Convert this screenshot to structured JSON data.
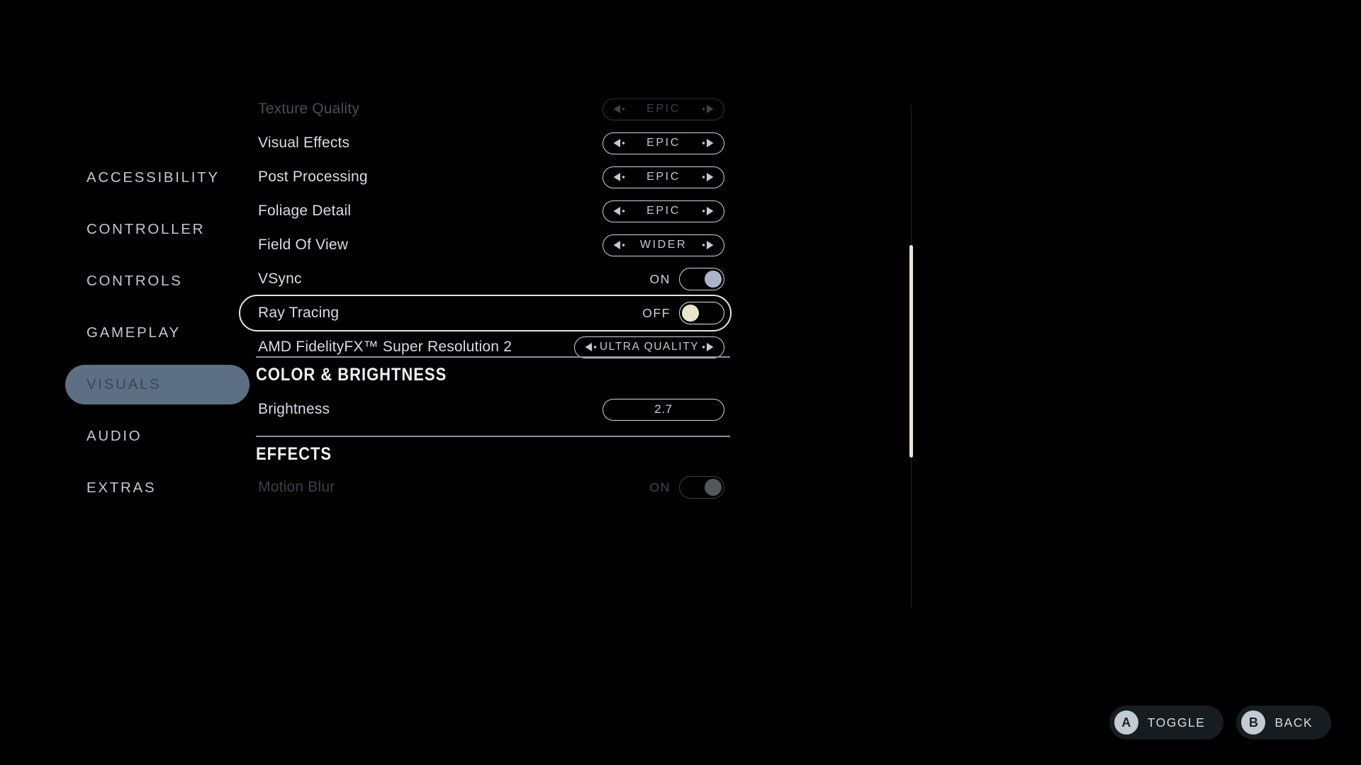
{
  "sidebar": {
    "items": [
      {
        "label": "ACCESSIBILITY",
        "active": false
      },
      {
        "label": "CONTROLLER",
        "active": false
      },
      {
        "label": "CONTROLS",
        "active": false
      },
      {
        "label": "GAMEPLAY",
        "active": false
      },
      {
        "label": "VISUALS",
        "active": true
      },
      {
        "label": "AUDIO",
        "active": false
      },
      {
        "label": "EXTRAS",
        "active": false
      }
    ]
  },
  "settings": {
    "rows": [
      {
        "label": "Texture Quality",
        "type": "selector",
        "value": "EPIC",
        "dimmed": true
      },
      {
        "label": "Visual Effects",
        "type": "selector",
        "value": "EPIC",
        "dimmed": false
      },
      {
        "label": "Post Processing",
        "type": "selector",
        "value": "EPIC",
        "dimmed": false
      },
      {
        "label": "Foliage Detail",
        "type": "selector",
        "value": "EPIC",
        "dimmed": false
      },
      {
        "label": "Field Of View",
        "type": "selector",
        "value": "WIDER",
        "dimmed": false
      },
      {
        "label": "VSync",
        "type": "toggle",
        "value": "ON",
        "dimmed": false
      },
      {
        "label": "Ray Tracing",
        "type": "toggle",
        "value": "OFF",
        "dimmed": false,
        "selected": true
      },
      {
        "label": "AMD FidelityFX™ Super Resolution 2",
        "type": "selector-wide",
        "value": "ULTRA QUALITY",
        "dimmed": false
      }
    ],
    "sections": [
      {
        "heading": "COLOR & BRIGHTNESS"
      },
      {
        "heading": "EFFECTS"
      }
    ],
    "brightness": {
      "label": "Brightness",
      "value": "2.7"
    },
    "motion_blur": {
      "label": "Motion Blur",
      "value": "ON"
    }
  },
  "footer": {
    "hints": [
      {
        "button": "A",
        "label": "TOGGLE"
      },
      {
        "button": "B",
        "label": "BACK"
      }
    ]
  },
  "colors": {
    "highlight_border": "#E9E6CF",
    "active_nav_pill": "#5D7083",
    "toggle_on_knob": "#A9B6C9",
    "toggle_off_knob": "#E9E5C8",
    "scrollbar_thumb": "#E9E6CF"
  }
}
